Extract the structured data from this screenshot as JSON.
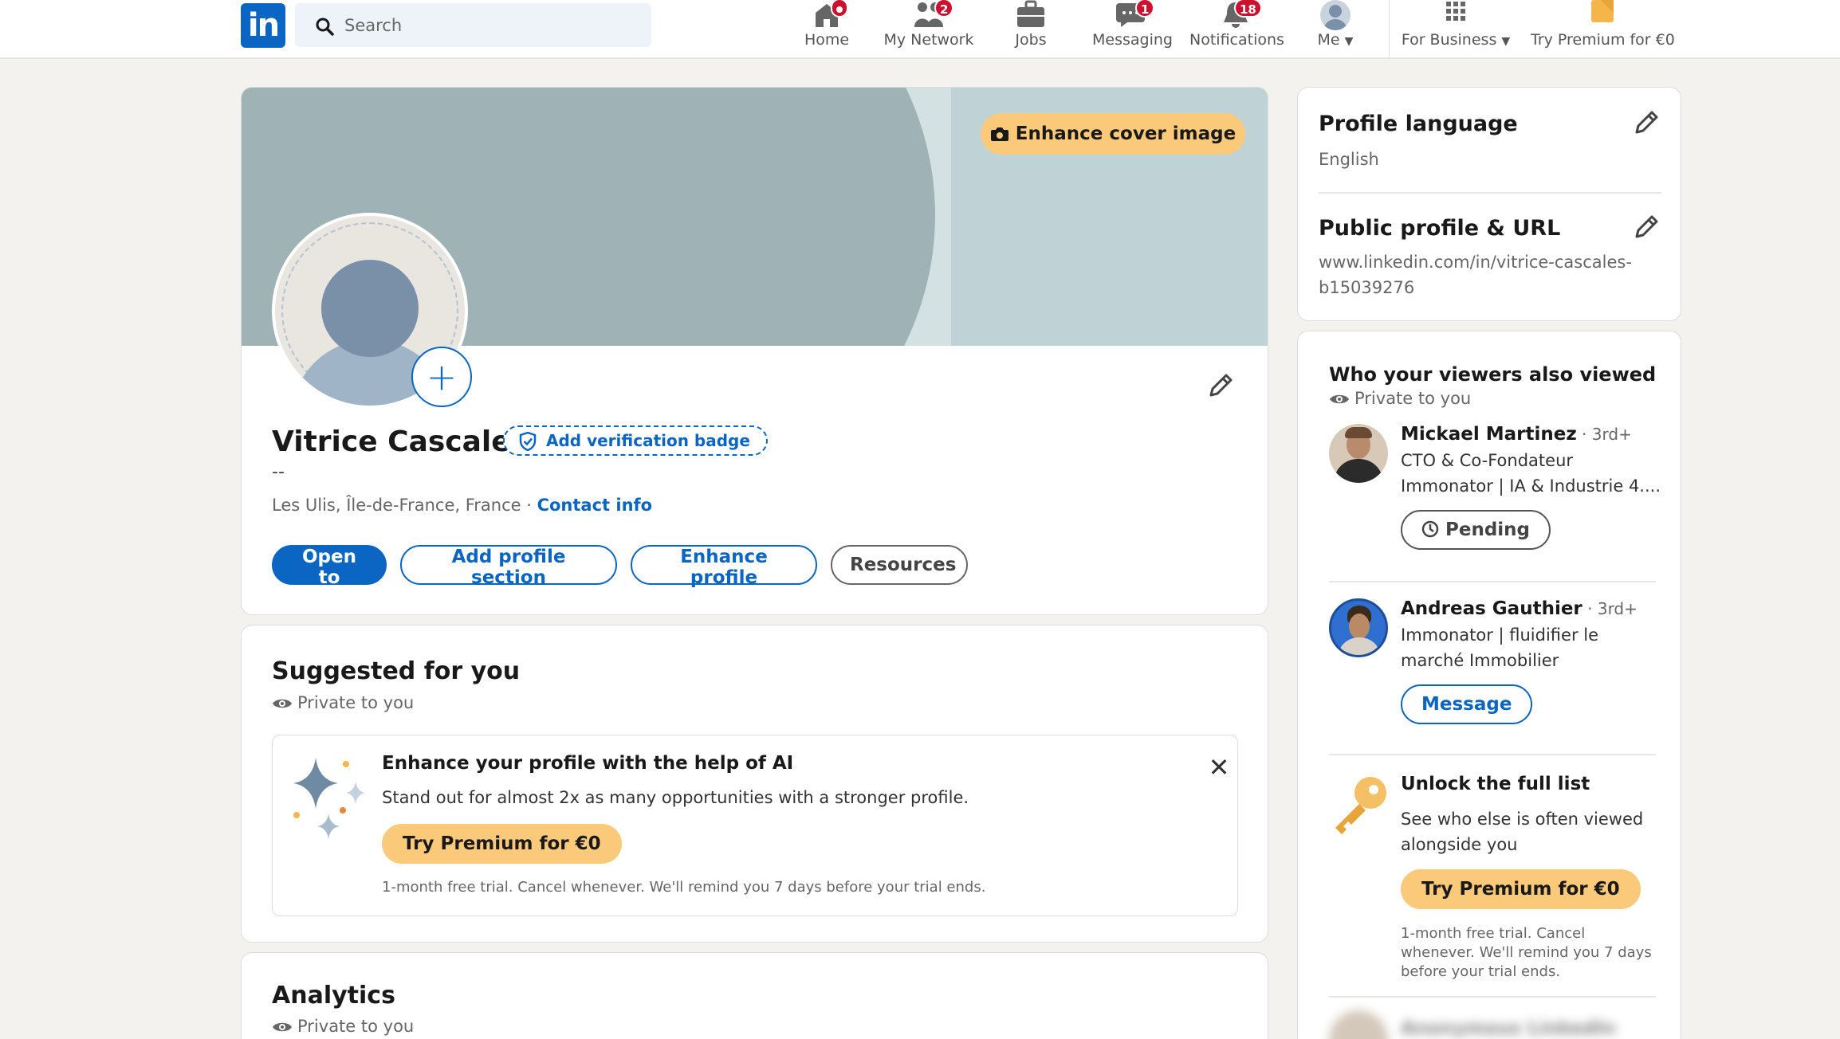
{
  "nav": {
    "logo": "in",
    "search_placeholder": "Search",
    "items": [
      {
        "label": "Home",
        "badge": ""
      },
      {
        "label": "My Network",
        "badge": "2"
      },
      {
        "label": "Jobs",
        "badge": ""
      },
      {
        "label": "Messaging",
        "badge": "1"
      },
      {
        "label": "Notifications",
        "badge": "18"
      },
      {
        "label": "Me"
      },
      {
        "label": "For Business"
      },
      {
        "label": "Try Premium for €0"
      }
    ]
  },
  "profile": {
    "enhance_cover": "Enhance cover image",
    "add_photo": "+",
    "name": "Vitrice Cascales",
    "verification": "Add verification badge",
    "headline": "--",
    "location": "Les Ulis, Île-de-France, France · ",
    "contact_info": "Contact info",
    "buttons": {
      "open_to": "Open to",
      "add_section": "Add profile section",
      "enhance": "Enhance profile",
      "resources": "Resources"
    }
  },
  "suggested": {
    "title": "Suggested for you",
    "privacy": "Private to you",
    "ai_title": "Enhance your profile with the help of AI",
    "ai_desc": "Stand out for almost 2x as many opportunities with a stronger profile.",
    "ai_button": "Try Premium for €0",
    "ai_note": "1-month free trial. Cancel whenever. We'll remind you 7 days before your trial ends.",
    "close": "✕"
  },
  "analytics": {
    "title": "Analytics",
    "privacy": "Private to you"
  },
  "sidebar": {
    "profile_language_title": "Profile language",
    "profile_language_value": "English",
    "public_profile_title": "Public profile & URL",
    "public_profile_url_1": "www.linkedin.com/in/vitrice-cascales-",
    "public_profile_url_2": "b15039276"
  },
  "viewers": {
    "title": "Who your viewers also viewed",
    "privacy": "Private to you",
    "people": [
      {
        "name": "Mickael Martinez",
        "degree": " · 3rd+",
        "line1": "CTO & Co-Fondateur",
        "line2": "Immonator | IA & Industrie 4....",
        "button": "Pending"
      },
      {
        "name": "Andreas Gauthier",
        "degree": " · 3rd+",
        "line1": "Immonator | fluidifier le",
        "line2": "marché Immobilier",
        "button": "Message"
      }
    ],
    "unlock_title": "Unlock the full list",
    "unlock_desc": "See who else is often viewed alongside you",
    "unlock_button": "Try Premium for €0",
    "unlock_note": "1-month free trial. Cancel whenever. We'll remind you 7 days before your trial ends.",
    "blurred_name": "Anonymous LinkedIn"
  },
  "colors": {
    "brand": "#0a66c2",
    "premium": "#fbc97a",
    "notification": "#cb112d"
  }
}
